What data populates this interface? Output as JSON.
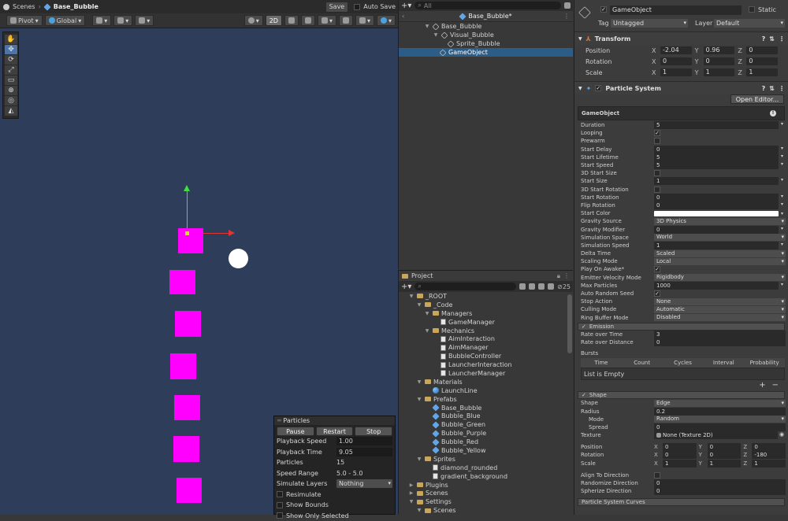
{
  "scene_toolbar": {
    "breadcrumb_root": "Scenes",
    "breadcrumb_prefab": "Base_Bubble",
    "pivot": "Pivot",
    "global": "Global",
    "mode_2d": "2D",
    "save": "Save",
    "auto_save": "Auto Save"
  },
  "particles_overlay": {
    "title": "Particles",
    "pause": "Pause",
    "restart": "Restart",
    "stop": "Stop",
    "rows": [
      {
        "label": "Playback Speed",
        "value": "1.00"
      },
      {
        "label": "Playback Time",
        "value": "9.05"
      },
      {
        "label": "Particles",
        "value": "15"
      },
      {
        "label": "Speed Range",
        "value": "5.0 - 5.0"
      },
      {
        "label": "Simulate Layers",
        "value": "Nothing"
      }
    ],
    "resimulate": "Resimulate",
    "show_bounds": "Show Bounds",
    "show_only_selected": "Show Only Selected"
  },
  "hierarchy": {
    "search_placeholder": "All",
    "prefab_title": "Base_Bubble*",
    "items": [
      "Base_Bubble",
      "Visual_Bubble",
      "Sprite_Bubble",
      "GameObject"
    ]
  },
  "project": {
    "title": "Project",
    "count": "25",
    "items": [
      {
        "label": "_ROOT",
        "depth": 0
      },
      {
        "label": "_Code",
        "depth": 1
      },
      {
        "label": "Managers",
        "depth": 2
      },
      {
        "label": "GameManager",
        "depth": 3
      },
      {
        "label": "Mechanics",
        "depth": 2
      },
      {
        "label": "AimInteraction",
        "depth": 3
      },
      {
        "label": "AimManager",
        "depth": 3
      },
      {
        "label": "BubbleController",
        "depth": 3
      },
      {
        "label": "LauncherInteraction",
        "depth": 3
      },
      {
        "label": "LauncherManager",
        "depth": 3
      },
      {
        "label": "Materials",
        "depth": 1
      },
      {
        "label": "LaunchLine",
        "depth": 2
      },
      {
        "label": "Prefabs",
        "depth": 1
      },
      {
        "label": "Base_Bubble",
        "depth": 2
      },
      {
        "label": "Bubble_Blue",
        "depth": 2
      },
      {
        "label": "Bubble_Green",
        "depth": 2
      },
      {
        "label": "Bubble_Purple",
        "depth": 2
      },
      {
        "label": "Bubble_Red",
        "depth": 2
      },
      {
        "label": "Bubble_Yellow",
        "depth": 2
      },
      {
        "label": "Sprites",
        "depth": 1
      },
      {
        "label": "diamond_rounded",
        "depth": 2
      },
      {
        "label": "gradient_background",
        "depth": 2
      },
      {
        "label": "Plugins",
        "depth": 0
      },
      {
        "label": "Scenes",
        "depth": 0
      },
      {
        "label": "Settings",
        "depth": 0
      },
      {
        "label": "Scenes",
        "depth": 1
      }
    ]
  },
  "inspector": {
    "name": "GameObject",
    "static": "Static",
    "tag_label": "Tag",
    "tag": "Untagged",
    "layer_label": "Layer",
    "layer": "Default",
    "transform": {
      "title": "Transform",
      "position_label": "Position",
      "rotation_label": "Rotation",
      "scale_label": "Scale",
      "position": [
        "-2.04",
        "0.96",
        "0"
      ],
      "rotation": [
        "0",
        "0",
        "0"
      ],
      "scale": [
        "1",
        "1",
        "1"
      ]
    },
    "ps": {
      "title": "Particle System",
      "open_editor": "Open Editor...",
      "object_name": "GameObject",
      "props": [
        {
          "label": "Duration",
          "value": "5",
          "kind": "field"
        },
        {
          "label": "Looping",
          "value": "✓",
          "kind": "check"
        },
        {
          "label": "Prewarm",
          "value": "",
          "kind": "check"
        },
        {
          "label": "Start Delay",
          "value": "0",
          "kind": "field"
        },
        {
          "label": "Start Lifetime",
          "value": "5",
          "kind": "field"
        },
        {
          "label": "Start Speed",
          "value": "5",
          "kind": "field"
        },
        {
          "label": "3D Start Size",
          "value": "",
          "kind": "check"
        },
        {
          "label": "Start Size",
          "value": "1",
          "kind": "field"
        },
        {
          "label": "3D Start Rotation",
          "value": "",
          "kind": "check"
        },
        {
          "label": "Start Rotation",
          "value": "0",
          "kind": "field"
        },
        {
          "label": "Flip Rotation",
          "value": "0",
          "kind": "field"
        },
        {
          "label": "Start Color",
          "value": "",
          "kind": "color"
        },
        {
          "label": "Gravity Source",
          "value": "3D Physics",
          "kind": "drop"
        },
        {
          "label": "Gravity Modifier",
          "value": "0",
          "kind": "field"
        },
        {
          "label": "Simulation Space",
          "value": "World",
          "kind": "drop"
        },
        {
          "label": "Simulation Speed",
          "value": "1",
          "kind": "field"
        },
        {
          "label": "Delta Time",
          "value": "Scaled",
          "kind": "drop"
        },
        {
          "label": "Scaling Mode",
          "value": "Local",
          "kind": "drop"
        },
        {
          "label": "Play On Awake*",
          "value": "✓",
          "kind": "check"
        },
        {
          "label": "Emitter Velocity Mode",
          "value": "Rigidbody",
          "kind": "drop"
        },
        {
          "label": "Max Particles",
          "value": "1000",
          "kind": "field"
        },
        {
          "label": "Auto Random Seed",
          "value": "✓",
          "kind": "check"
        },
        {
          "label": "Stop Action",
          "value": "None",
          "kind": "drop"
        },
        {
          "label": "Culling Mode",
          "value": "Automatic",
          "kind": "drop"
        },
        {
          "label": "Ring Buffer Mode",
          "value": "Disabled",
          "kind": "drop"
        }
      ],
      "emission": {
        "title": "Emission",
        "rate_time_label": "Rate over Time",
        "rate_time": "3",
        "rate_dist_label": "Rate over Distance",
        "rate_dist": "0",
        "bursts": "Bursts",
        "cols": [
          "Time",
          "Count",
          "Cycles",
          "Interval",
          "Probability"
        ],
        "empty": "List is Empty"
      },
      "shape": {
        "title": "Shape",
        "shape_label": "Shape",
        "shape": "Edge",
        "radius_label": "Radius",
        "radius": "0.2",
        "mode_label": "Mode",
        "mode": "Random",
        "spread_label": "Spread",
        "spread": "0",
        "texture_label": "Texture",
        "texture": "None (Texture 2D)",
        "position_label": "Position",
        "rotation_label": "Rotation",
        "scale_label": "Scale",
        "position": [
          "0",
          "0",
          "0"
        ],
        "rotation": [
          "0",
          "0",
          "-180"
        ],
        "scale": [
          "1",
          "1",
          "1"
        ],
        "align_label": "Align To Direction",
        "rand_dir_label": "Randomize Direction",
        "rand_dir": "0",
        "sphere_dir_label": "Spherize Direction",
        "sphere_dir": "0"
      },
      "next_module": "Particle System Curves"
    }
  }
}
